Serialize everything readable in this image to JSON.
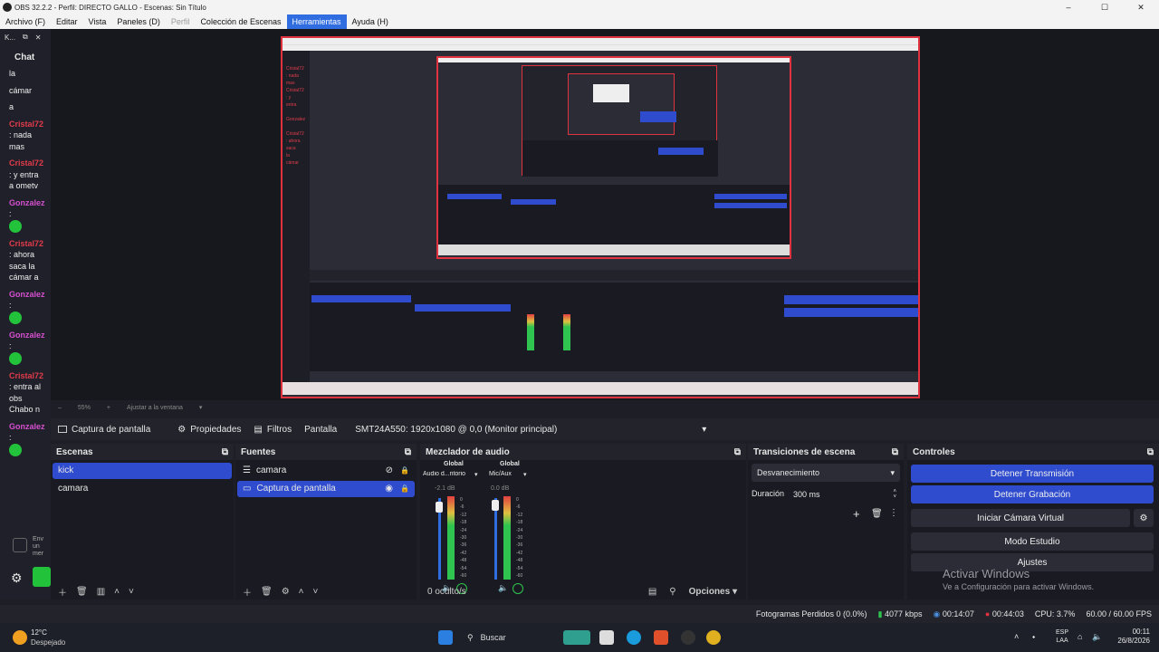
{
  "window": {
    "title": "OBS 32.2.2 - Perfil: DIRECTO GALLO - Escenas: Sin Título",
    "min": "–",
    "max": "☐",
    "close": "✕"
  },
  "menu": [
    {
      "label": "Archivo (F)",
      "state": "normal"
    },
    {
      "label": "Editar",
      "state": "normal"
    },
    {
      "label": "Vista",
      "state": "normal"
    },
    {
      "label": "Paneles (D)",
      "state": "normal"
    },
    {
      "label": "Perfil",
      "state": "disabled"
    },
    {
      "label": "Colección de Escenas",
      "state": "normal"
    },
    {
      "label": "Herramientas",
      "state": "active"
    },
    {
      "label": "Ayuda (H)",
      "state": "normal"
    }
  ],
  "chat": {
    "header": "K...",
    "title": "Chat",
    "messages": [
      {
        "text": "la"
      },
      {
        "text": "cámar"
      },
      {
        "text": "a"
      },
      {
        "name": "Cristal72",
        "text": ": nada mas"
      },
      {
        "name": "Cristal72",
        "text": ": y entra a ometv"
      },
      {
        "name": "Gonzalez",
        "text": ":"
      },
      {
        "name": "Cristal72",
        "text": ": ahora saca la cámar a"
      },
      {
        "name": "Gonzalez",
        "text": ":"
      },
      {
        "name": "Gonzalez",
        "text": ":"
      },
      {
        "name": "Cristal72",
        "text": ": entra al obs Chabo n"
      },
      {
        "name": "Gonzalez",
        "text": ":"
      }
    ],
    "footer_text": "Env un mer"
  },
  "preview_controls": {
    "zoom": "55%",
    "fit": "Ajustar a la ventana"
  },
  "source_toolbar": {
    "source_name": "Captura de pantalla",
    "properties": "Propiedades",
    "filters": "Filtros",
    "screen_label": "Pantalla",
    "screen_value": "SMT24A550: 1920x1080 @ 0,0 (Monitor principal)"
  },
  "scenes": {
    "title": "Escenas",
    "items": [
      "kick",
      "camara"
    ],
    "selected": 0
  },
  "sources": {
    "title": "Fuentes",
    "items": [
      {
        "label": "camara"
      },
      {
        "label": "Captura de pantalla"
      }
    ],
    "selected": 1
  },
  "mixer": {
    "title": "Mezclador de audio",
    "channels": [
      {
        "tag": "Global",
        "name": "Audio d...ritorio",
        "db": "-2.1 dB"
      },
      {
        "tag": "Global",
        "name": "Mic/Aux",
        "db": "0.0 dB"
      }
    ],
    "scale": [
      "0",
      "-6",
      "-12",
      "-18",
      "-24",
      "-30",
      "-36",
      "-42",
      "-48",
      "-54",
      "-60"
    ],
    "hidden": "0 oculto/s",
    "options": "Opciones"
  },
  "transitions": {
    "title": "Transiciones de escena",
    "type": "Desvanecimiento",
    "duration_label": "Duración",
    "duration_value": "300 ms"
  },
  "controls": {
    "title": "Controles",
    "buttons": [
      "Detener Transmisión",
      "Detener Grabación",
      "Iniciar Cámara Virtual",
      "Modo Estudio",
      "Ajustes"
    ]
  },
  "watermark": {
    "line1": "Activar Windows",
    "line2": "Ve a Configuración para activar Windows."
  },
  "status": {
    "dropped": "Fotogramas Perdidos 0 (0.0%)",
    "bitrate": "4077 kbps",
    "stream_time": "00:14:07",
    "rec_time": "00:44:03",
    "cpu": "CPU: 3.7%",
    "fps": "60.00 / 60.00 FPS"
  },
  "taskbar": {
    "weather_temp": "12°C",
    "weather_desc": "Despejado",
    "search": "Buscar",
    "lang": "ESP",
    "lang2": "LAA",
    "time": "00:11",
    "date": "26/8/2026"
  },
  "colors": {
    "accent": "#2f4ccf",
    "record": "#e0323f",
    "bg": "#1e1f26"
  }
}
